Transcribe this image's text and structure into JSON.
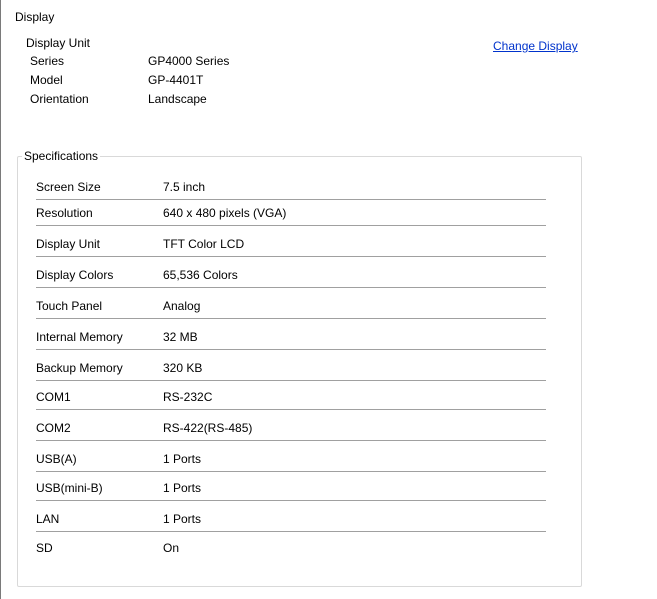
{
  "display": {
    "section_title": "Display",
    "unit_title": "Display Unit",
    "change_link": "Change Display",
    "info": [
      {
        "label": "Series",
        "value": "GP4000 Series"
      },
      {
        "label": "Model",
        "value": "GP-4401T"
      },
      {
        "label": "Orientation",
        "value": "Landscape"
      }
    ]
  },
  "specifications": {
    "title": "Specifications",
    "rows": [
      {
        "label": "Screen Size",
        "value": "7.5 inch"
      },
      {
        "label": "Resolution",
        "value": "640 x 480 pixels (VGA)"
      },
      {
        "label": "Display Unit",
        "value": "TFT Color LCD"
      },
      {
        "label": "Display Colors",
        "value": "65,536 Colors"
      },
      {
        "label": "Touch Panel",
        "value": "Analog"
      },
      {
        "label": "Internal Memory",
        "value": "32 MB"
      },
      {
        "label": "Backup Memory",
        "value": "320 KB"
      },
      {
        "label": "COM1",
        "value": "RS-232C"
      },
      {
        "label": "COM2",
        "value": "RS-422(RS-485)"
      },
      {
        "label": "USB(A)",
        "value": "1 Ports"
      },
      {
        "label": "USB(mini-B)",
        "value": "1 Ports"
      },
      {
        "label": "LAN",
        "value": "1 Ports"
      },
      {
        "label": "SD",
        "value": "On"
      }
    ]
  },
  "colors": {
    "link": "#0033cc",
    "divider": "#a0a0a0",
    "group_border": "#d9d9d9"
  }
}
